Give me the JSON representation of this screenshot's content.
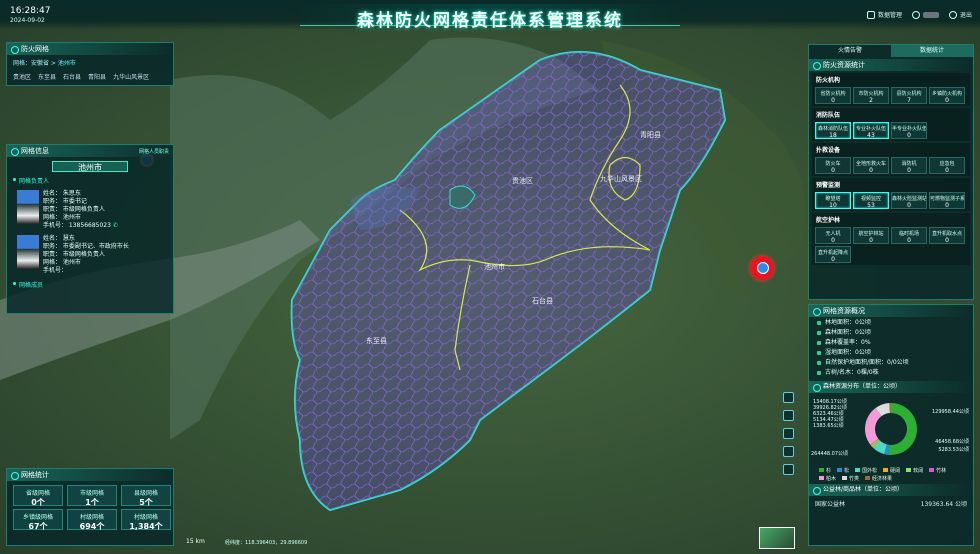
{
  "header": {
    "time": "16:28:47",
    "date": "2024-09-02",
    "title": "森林防火网格责任体系管理系统",
    "manage_label": "数据管理",
    "exit_label": "退出"
  },
  "colors": {
    "accent": "#2ad1b6",
    "panel": "#062628",
    "boundary": "#38e0d0",
    "district_line": "#d7e84a",
    "mesh": "#8a5fd6",
    "alert": "#e8141f"
  },
  "left": {
    "grid": {
      "title": "防火网格",
      "breadcrumb_label": "网格：",
      "breadcrumb_path": "安徽省 > ",
      "breadcrumb_current": "池州市",
      "districts": [
        "贵池区",
        "东至县",
        "石台县",
        "青阳县",
        "九华山风景区"
      ]
    },
    "info": {
      "title": "网格信息",
      "link": "网格人员职责",
      "city": "池州市",
      "group1": "网格负责人",
      "group2": "网格成员",
      "people": [
        {
          "name": "姓名： 朱思东",
          "duty": "职务： 市委书记",
          "role": "职责： 市级网格负责人",
          "area": "网格： 池州市",
          "phone_label": "手机号： ",
          "phone": "13856685023"
        },
        {
          "name": "姓名： 慧东",
          "duty": "职务： 市委副书记、市政府市长",
          "role": "职责： 市级网格负责人",
          "area": "网格： 池州市",
          "phone_label": "手机号：",
          "phone": ""
        }
      ]
    },
    "stats": {
      "title": "网格统计",
      "items": [
        {
          "label": "省级网格",
          "value": "0个"
        },
        {
          "label": "市级网格",
          "value": "1个"
        },
        {
          "label": "县级网格",
          "value": "5个"
        },
        {
          "label": "乡镇级网格",
          "value": "67个"
        },
        {
          "label": "村级网格",
          "value": "694个"
        },
        {
          "label": "村级网格",
          "value": "1,384个"
        }
      ]
    }
  },
  "right": {
    "tabs": [
      "火情告警",
      "数据统计"
    ],
    "resource_title": "防火资源统计",
    "groups": [
      {
        "title": "防火机构",
        "items": [
          {
            "l": "省防火机构",
            "v": "0"
          },
          {
            "l": "市防火机构",
            "v": "2"
          },
          {
            "l": "县防火机构",
            "v": "7"
          },
          {
            "l": "乡镇防火机构",
            "v": "0"
          }
        ]
      },
      {
        "title": "消防队伍",
        "items": [
          {
            "l": "森林消防队伍",
            "v": "18"
          },
          {
            "l": "专业扑火队伍",
            "v": "43"
          },
          {
            "l": "半专业扑火队伍",
            "v": "0"
          }
        ]
      },
      {
        "title": "扑救设备",
        "items": [
          {
            "l": "防火车",
            "v": "0"
          },
          {
            "l": "全地形救火车",
            "v": "0"
          },
          {
            "l": "消防机",
            "v": "0"
          },
          {
            "l": "应急包",
            "v": "0"
          }
        ]
      },
      {
        "title": "预警监测",
        "items": [
          {
            "l": "瞭望塔",
            "v": "10"
          },
          {
            "l": "视频监控",
            "v": "53"
          },
          {
            "l": "森林火险监测站",
            "v": "0"
          },
          {
            "l": "可燃物监测子系统",
            "v": "0"
          }
        ]
      },
      {
        "title": "航空护林",
        "items": [
          {
            "l": "无人机",
            "v": "0"
          },
          {
            "l": "航空护林站",
            "v": "0"
          },
          {
            "l": "临时机场",
            "v": "0"
          },
          {
            "l": "直升机取水点",
            "v": "0"
          },
          {
            "l": "直升机起降点",
            "v": "0"
          }
        ]
      }
    ],
    "overview_title": "网格资源概况",
    "overview": [
      "林地面积：0公顷",
      "森林面积：0公顷",
      "森林覆盖率：0%",
      "湿地面积：0公顷",
      "自然保护地面积/面积：0/0公顷",
      "古树/名木：0棵/0株"
    ],
    "dist_title": "森林资源分布（单位：公顷）",
    "legend": [
      "杉",
      "松",
      "国外松",
      "硬阔",
      "软阔",
      "竹林",
      "柏木",
      "竹类",
      "经济林果"
    ],
    "public_title": "公益林/商品林（单位：公顷）",
    "public_row_label": "国家公益林",
    "public_row_value": "139363.64 公顷"
  },
  "map": {
    "labels": [
      "贵池区",
      "青阳县",
      "九华山风景区",
      "池州市",
      "石台县",
      "东至县"
    ],
    "scale": "15 km",
    "coords": "经纬度：118.396403，29.896609"
  },
  "chart_data": {
    "type": "pie",
    "title": "森林资源分布（单位：公顷）",
    "values": [
      264448.07,
      13408.17,
      39926.82,
      6323.46,
      5134.47,
      1383.65,
      129958.44,
      46458.68,
      5283.53
    ],
    "labels": [
      "264448.07公顷",
      "13408.17公顷",
      "39926.82公顷",
      "6323.46公顷",
      "5134.47公顷",
      "1383.65公顷",
      "129958.44公顷",
      "46458.68公顷",
      "5283.53公顷"
    ],
    "colors": [
      "#2fae34",
      "#2b8cd6",
      "#4dd9c7",
      "#e0b02a",
      "#8ee06a",
      "#d45ad0",
      "#f39ad8",
      "#ddd",
      "#9a6d3c"
    ]
  }
}
